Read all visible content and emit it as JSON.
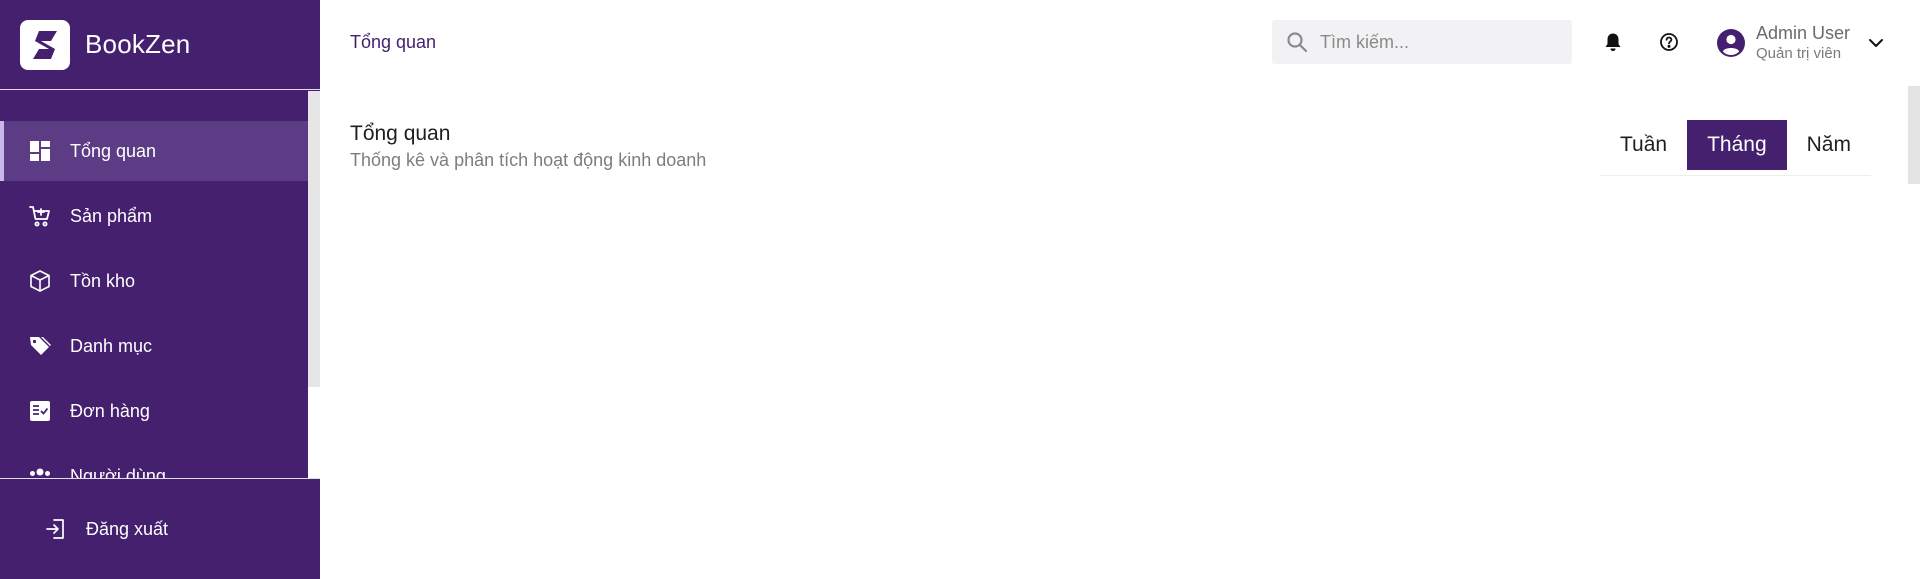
{
  "brand": {
    "name": "BookZen",
    "logo_icon": "bookzen-logo-icon"
  },
  "colors": {
    "sidebar": "#44206f",
    "accent": "#44206f",
    "active_item": "#5b3c85"
  },
  "sidebar": {
    "items": [
      {
        "label": "Tổng quan",
        "icon": "dashboard-icon",
        "active": true
      },
      {
        "label": "Sản phẩm",
        "icon": "cart-icon"
      },
      {
        "label": "Tồn kho",
        "icon": "box-icon"
      },
      {
        "label": "Danh mục",
        "icon": "tag-icon"
      },
      {
        "label": "Đơn hàng",
        "icon": "checklist-icon"
      },
      {
        "label": "Người dùng",
        "icon": "users-icon"
      }
    ],
    "logout_label": "Đăng xuất"
  },
  "header": {
    "breadcrumb": "Tổng quan",
    "search_placeholder": "Tìm kiếm...",
    "user": {
      "name": "Admin User",
      "role": "Quản trị viên"
    }
  },
  "main": {
    "title": "Tổng quan",
    "subtitle": "Thống kê và phân tích hoạt động kinh doanh",
    "periods": [
      "Tuần",
      "Tháng",
      "Năm"
    ],
    "selected_period": "Tháng"
  }
}
